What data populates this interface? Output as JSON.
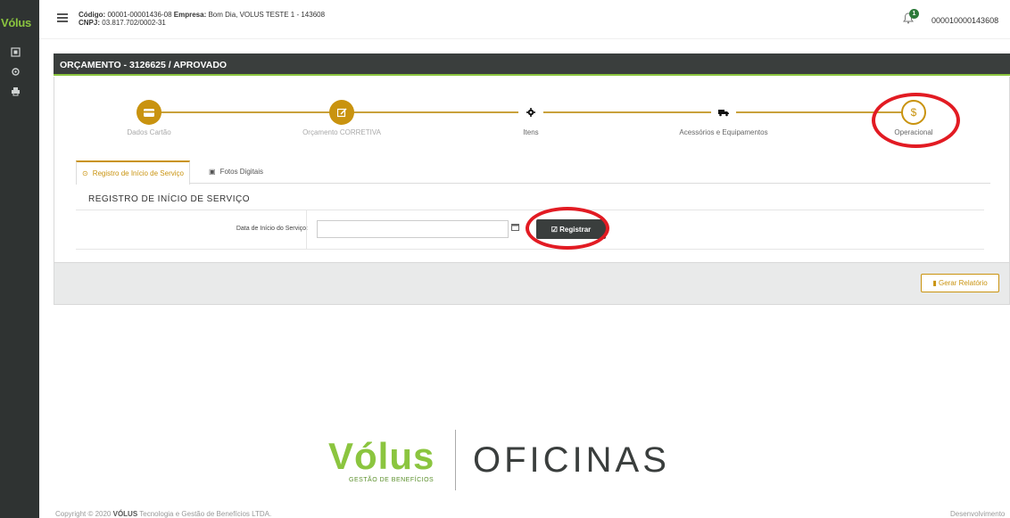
{
  "sidebar": {
    "brand": "Vólus"
  },
  "header": {
    "codigo_label": "Código:",
    "codigo_value": "00001-00001436-08",
    "empresa_label": "Empresa:",
    "empresa_value": "Bom Dia, VOLUS TESTE 1 - 143608",
    "cnpj_label": "CNPJ:",
    "cnpj_value": "03.817.702/0002-31",
    "notification_count": "1",
    "user_code": "000010000143608"
  },
  "panel": {
    "title": "ORÇAMENTO - 3126625 / APROVADO"
  },
  "wizard": {
    "steps": [
      {
        "label": "Dados Cartão",
        "icon": "credit-card-icon",
        "state": "done"
      },
      {
        "label": "Orçamento CORRETIVA",
        "icon": "edit-icon",
        "state": "done"
      },
      {
        "label": "Itens",
        "icon": "gear-icon",
        "state": "todo"
      },
      {
        "label": "Acessórios e Equipamentos",
        "icon": "truck-icon",
        "state": "todo"
      },
      {
        "label": "Operacional",
        "icon": "dollar-icon",
        "state": "current"
      }
    ]
  },
  "tabs": [
    {
      "label": "Registro de Início de Serviço",
      "active": true
    },
    {
      "label": "Fotos Digitais",
      "active": false
    }
  ],
  "section": {
    "title": "REGISTRO DE INÍCIO DE SERVIÇO",
    "date_label": "Data de Início do Serviço:",
    "date_value": "",
    "register_button": "Registrar"
  },
  "footer_actions": {
    "report_button": "Gerar Relatório"
  },
  "logo": {
    "word": "Vólus",
    "sub": "GESTÃO DE BENEFÍCIOS",
    "product": "OFICINAS"
  },
  "footer": {
    "copyright_prefix": "Copyright © 2020",
    "copyright_brand": "VÓLUS",
    "copyright_suffix": "Tecnologia e Gestão de Benefícios LTDA.",
    "dev_text": "Desenvolvimento"
  },
  "colors": {
    "accent": "#c9930f",
    "brand_green": "#8bc53f",
    "dark": "#3a3e3d",
    "highlight_ring": "#e21b23"
  }
}
